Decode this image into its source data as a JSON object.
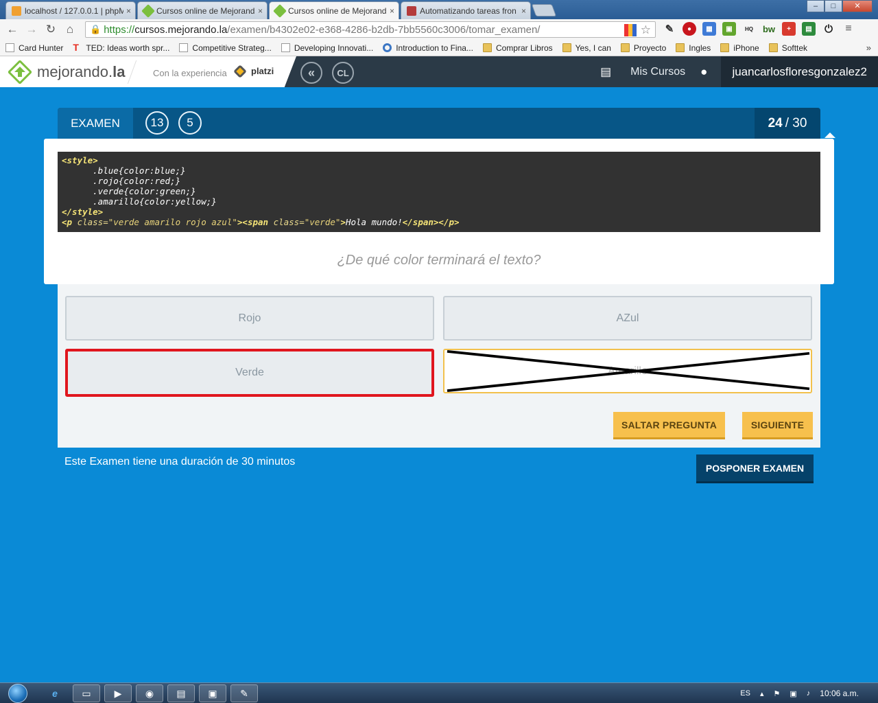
{
  "browser": {
    "tabs": [
      {
        "title": "localhost / 127.0.0.1 | phpM",
        "favicon_color": "#f0a030",
        "active": false
      },
      {
        "title": "Cursos online de Mejorand",
        "favicon_color": "#7bbf3e",
        "active": false
      },
      {
        "title": "Cursos online de Mejorand",
        "favicon_color": "#7bbf3e",
        "active": true
      },
      {
        "title": "Automatizando tareas fron",
        "favicon_color": "#b43b3b",
        "active": false
      }
    ],
    "close_glyph": "×",
    "url": {
      "scheme": "https://",
      "host": "cursos.mejorando.la",
      "path": "/examen/b4302e02-e368-4286-b2db-7bb5560c3006/tomar_examen/"
    },
    "bookmarks": [
      {
        "label": "Card Hunter",
        "icon": "page-icon"
      },
      {
        "label": "TED: Ideas worth spr...",
        "icon": "ted-icon"
      },
      {
        "label": "Competitive Strateg...",
        "icon": "page-icon"
      },
      {
        "label": "Developing Innovati...",
        "icon": "page-icon"
      },
      {
        "label": "Introduction to Fina...",
        "icon": "coursera-icon"
      },
      {
        "label": "Comprar Libros",
        "icon": "folder-icon"
      },
      {
        "label": "Yes, I can",
        "icon": "folder-icon"
      },
      {
        "label": "Proyecto",
        "icon": "folder-icon"
      },
      {
        "label": "Ingles",
        "icon": "folder-icon"
      },
      {
        "label": "iPhone",
        "icon": "folder-icon"
      },
      {
        "label": "Softtek",
        "icon": "folder-icon"
      }
    ],
    "bookmarks_more": "»"
  },
  "site": {
    "logo": {
      "light": "mejorando.",
      "bold": "la"
    },
    "tagline": "Con la experiencia",
    "partner": "platzi",
    "circle_buttons": [
      "«",
      "CL"
    ],
    "nav_link": "Mis Cursos",
    "username": "juancarlosfloresgonzalez2"
  },
  "exam": {
    "label": "EXAMEN",
    "badges": [
      "13",
      "5"
    ],
    "current": "24",
    "total": "/ 30",
    "code_lines": [
      [
        {
          "t": "tag",
          "v": "<style>"
        }
      ],
      [
        {
          "t": "txt",
          "v": "      .blue{color:blue;}"
        }
      ],
      [
        {
          "t": "txt",
          "v": "      .rojo{color:red;}"
        }
      ],
      [
        {
          "t": "txt",
          "v": "      .verde{color:green;}"
        }
      ],
      [
        {
          "t": "txt",
          "v": "      .amarillo{color:yellow;}"
        }
      ],
      [
        {
          "t": "tag",
          "v": "</style>"
        }
      ],
      [
        {
          "t": "tag",
          "v": "<p "
        },
        {
          "t": "attr",
          "v": "class="
        },
        {
          "t": "str",
          "v": "\"verde amarilo rojo azul\""
        },
        {
          "t": "tag",
          "v": "><span "
        },
        {
          "t": "attr",
          "v": "class="
        },
        {
          "t": "str",
          "v": "\"verde\""
        },
        {
          "t": "tag",
          "v": ">"
        },
        {
          "t": "txt",
          "v": "Hola mundo!"
        },
        {
          "t": "tag",
          "v": "</span></p>"
        }
      ]
    ],
    "question": "¿De qué color terminará el texto?",
    "answers": [
      {
        "label": "Rojo",
        "state": "normal"
      },
      {
        "label": "AZul",
        "state": "normal"
      },
      {
        "label": "Verde",
        "state": "marked-red"
      },
      {
        "label": "Amarillo",
        "state": "crossed-out"
      }
    ],
    "skip_label": "SALTAR PREGUNTA",
    "next_label": "SIGUIENTE",
    "duration_text": "Este Examen tiene una duración de 30 minutos",
    "postpone_label": "POSPONER EXAMEN"
  },
  "taskbar": {
    "lang": "ES",
    "time": "10:06 a.m."
  },
  "colors": {
    "page_bg": "#0a8ad6",
    "header_bg": "#2b3a47",
    "exam_head": "#075687",
    "accent_yellow": "#f7c04d",
    "marked_red": "#e0161e"
  }
}
